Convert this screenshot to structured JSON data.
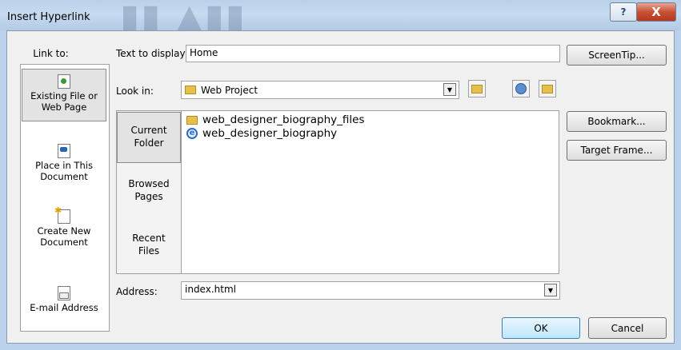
{
  "window": {
    "title": "Insert Hyperlink",
    "help_glyph": "?",
    "close_glyph": "X"
  },
  "link_pane": {
    "heading": "Link to:",
    "items": [
      {
        "label_1": "Existing File or",
        "label_2": "Web Page",
        "icon": "existing-file-icon"
      },
      {
        "label_1": "Place in This",
        "label_2": "Document",
        "icon": "place-in-document-icon"
      },
      {
        "label_1": "Create New",
        "label_2": "Document",
        "icon": "new-document-icon"
      },
      {
        "label_1": "E-mail Address",
        "label_2": "",
        "icon": "email-address-icon"
      }
    ]
  },
  "text_to_display": {
    "label": "Text to display:",
    "value": "Home"
  },
  "screentip_label": "ScreenTip...",
  "look_in": {
    "label": "Look in:",
    "value": "Web Project"
  },
  "places": [
    {
      "label_1": "Current",
      "label_2": "Folder"
    },
    {
      "label_1": "Browsed",
      "label_2": "Pages"
    },
    {
      "label_1": "Recent",
      "label_2": "Files"
    }
  ],
  "files": [
    {
      "name": "web_designer_biography_files",
      "icon": "folder-icon"
    },
    {
      "name": "web_designer_biography",
      "icon": "ie-page-icon"
    }
  ],
  "bookmark_label": "Bookmark...",
  "target_frame_label": "Target Frame...",
  "address": {
    "label": "Address:",
    "value": "index.html"
  },
  "ok_label": "OK",
  "cancel_label": "Cancel"
}
